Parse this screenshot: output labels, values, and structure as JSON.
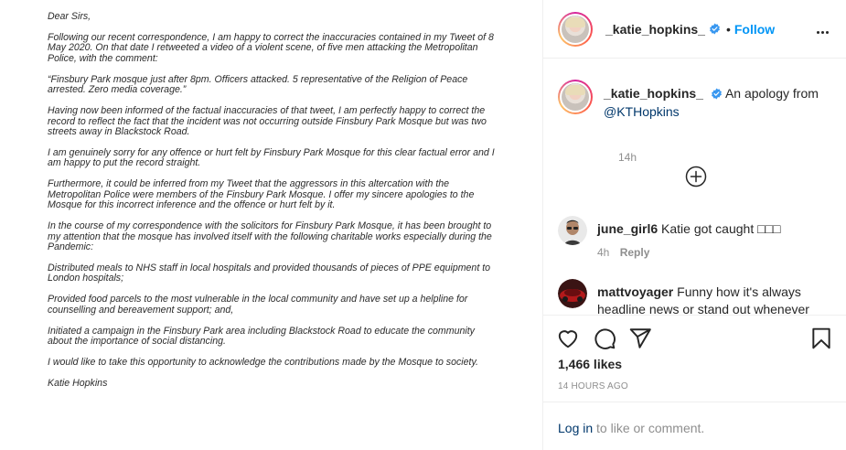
{
  "letter": {
    "paragraphs": [
      "Dear Sirs,",
      "Following our recent correspondence, I am happy to correct the inaccuracies contained in my Tweet of 8 May 2020. On that date I retweeted a video of a violent scene, of five men attacking the Metropolitan Police, with the comment:",
      "“Finsbury Park mosque just after 8pm. Officers attacked. 5 representative of the Religion of Peace arrested. Zero media coverage.”",
      "Having now been informed of the factual inaccuracies of that tweet, I am perfectly happy to correct the record to reflect the fact that the incident was not occurring outside Finsbury Park Mosque but was two streets away in Blackstock Road.",
      "I am genuinely sorry for any offence or hurt felt by Finsbury Park Mosque for this clear factual error and I am happy to put the record straight.",
      "Furthermore, it could be inferred from my Tweet that the aggressors in this altercation with the Metropolitan Police were members of the Finsbury Park Mosque. I offer my sincere apologies to the Mosque for this incorrect inference and the offence or hurt felt by it.",
      "In the course of my correspondence with the solicitors for Finsbury Park Mosque, it has been brought to my attention that the mosque has involved itself with the following charitable works especially during the Pandemic:",
      "Distributed meals to NHS staff in local hospitals and provided thousands of pieces of PPE equipment to London hospitals;",
      "Provided food parcels to the most vulnerable in the local community and have set up a helpline for counselling and bereavement support; and,",
      "Initiated a campaign in the Finsbury Park area including Blackstock Road to educate the community about the importance of social distancing.",
      "I would like to take this opportunity to acknowledge the contributions made by the Mosque to society.",
      "Katie Hopkins"
    ]
  },
  "header": {
    "username": "_katie_hopkins_",
    "separator": "•",
    "follow_label": "Follow"
  },
  "caption": {
    "username": "_katie_hopkins_",
    "text": "An apology from",
    "mention": "@KTHopkins",
    "timestamp": "14h"
  },
  "comments": [
    {
      "username": "june_girl6",
      "text": "Katie got caught □□□",
      "age": "4h",
      "reply_label": "Reply"
    },
    {
      "username": "mattvoyager",
      "text": "Funny how it's always headline news or stand out whenever"
    }
  ],
  "actions": {
    "likes": "1,466 likes",
    "time": "14 HOURS AGO"
  },
  "login": {
    "link": "Log in",
    "rest": " to like or comment."
  },
  "colors": {
    "accent": "#0095f6",
    "text": "#262626",
    "muted": "#8e8e8e",
    "border": "#efefef"
  }
}
